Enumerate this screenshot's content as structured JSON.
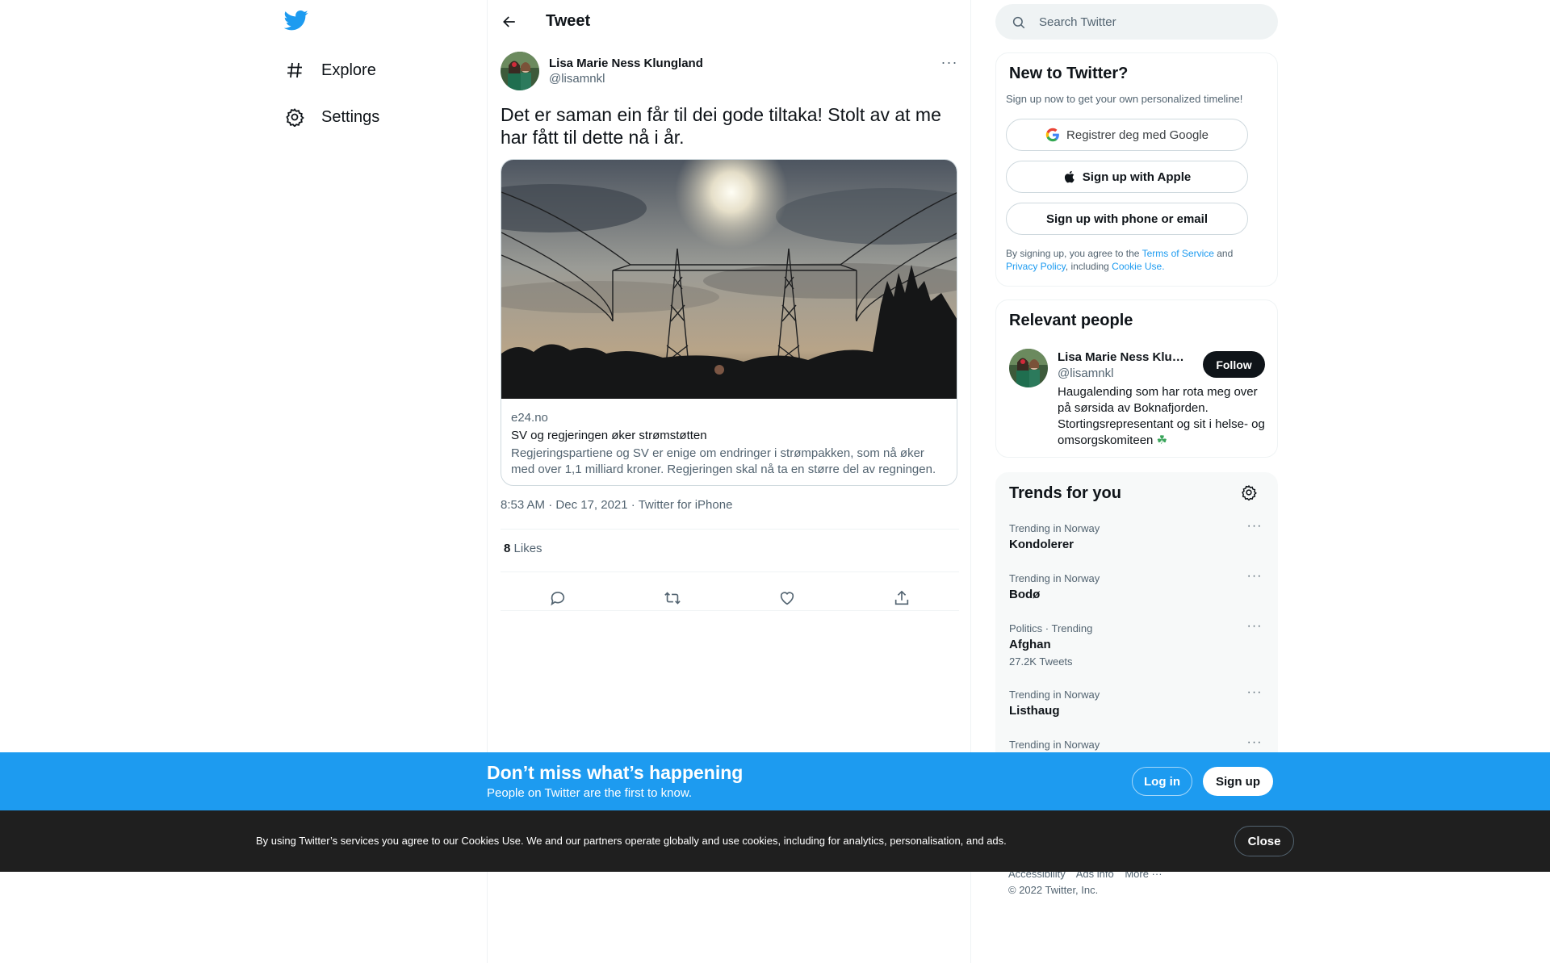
{
  "nav": {
    "logo": "twitter-bird-icon",
    "explore": "Explore",
    "settings": "Settings"
  },
  "header": {
    "title": "Tweet"
  },
  "tweet": {
    "author_name": "Lisa Marie Ness Klungland",
    "author_handle": "@lisamnkl",
    "text": "Det er saman ein får til dei gode tiltaka! Stolt av at me har fått til dette nå i år.",
    "card": {
      "domain": "e24.no",
      "title": "SV og regjeringen øker strømstøtten",
      "description": "Regjeringspartiene og SV er enige om endringer i strømpakken, som nå øker med over 1,1 milliard kroner. Regjeringen skal nå ta en større del av regningen. Og det blir flere som omfattes."
    },
    "time": "8:53 AM",
    "date": "Dec 17, 2021",
    "source": "Twitter for iPhone",
    "separator": " · ",
    "likes_count": "8",
    "likes_label": "Likes"
  },
  "search": {
    "placeholder": "Search Twitter"
  },
  "new_to_twitter": {
    "title": "New to Twitter?",
    "subtitle": "Sign up now to get your own personalized timeline!",
    "google": "Registrer deg med Google",
    "apple": "Sign up with Apple",
    "phone": "Sign up with phone or email",
    "legal_1": "By signing up, you agree to the ",
    "terms": "Terms of Service",
    "legal_2": " and ",
    "privacy": "Privacy Policy",
    "legal_3": ", including ",
    "cookie": "Cookie Use."
  },
  "relevant_people": {
    "title": "Relevant people",
    "name": "Lisa Marie Ness Klungland",
    "handle": "@lisamnkl",
    "follow": "Follow",
    "bio": "Haugalending som har rota meg over på sørsida av Boknafjorden. Stortingsrepresentant og sit i helse- og omsorgskomiteen",
    "bio_emoji": "☘"
  },
  "trends": {
    "title": "Trends for you",
    "items": [
      {
        "category": "Trending in Norway",
        "name": "Kondolerer",
        "count": ""
      },
      {
        "category": "Trending in Norway",
        "name": "Bodø",
        "count": ""
      },
      {
        "category": "Politics · Trending",
        "name": "Afghan",
        "count": "27.2K Tweets"
      },
      {
        "category": "Trending in Norway",
        "name": "Listhaug",
        "count": ""
      },
      {
        "category": "Trending in Norway",
        "name": "",
        "count": ""
      }
    ]
  },
  "footer": {
    "accessibility": "Accessibility",
    "ads": "Ads info",
    "more": "More ···",
    "copyright": "© 2022 Twitter, Inc."
  },
  "banner": {
    "title": "Don’t miss what’s happening",
    "subtitle": "People on Twitter are the first to know.",
    "login": "Log in",
    "signup": "Sign up"
  },
  "cookie_bar": {
    "text": "By using Twitter’s services you agree to our Cookies Use. We and our partners operate globally and use cookies, including for analytics, personalisation, and ads.",
    "close": "Close"
  },
  "colors": {
    "accent": "#1d9bf0",
    "text": "#0f1419",
    "muted": "#536471",
    "cookie_bg": "#1f1f1f"
  }
}
